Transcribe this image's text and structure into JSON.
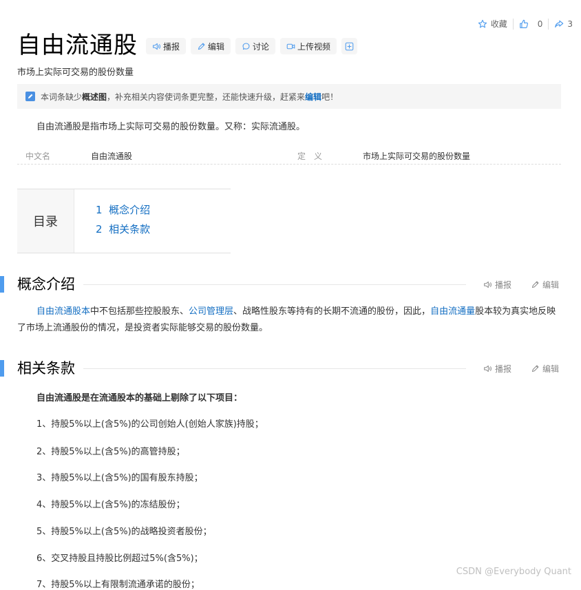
{
  "actions": {
    "favorite": "收藏",
    "like_count": "0",
    "share_count": "3"
  },
  "title": "自由流通股",
  "title_buttons": {
    "broadcast": "播报",
    "edit": "编辑",
    "discuss": "讨论",
    "upload_video": "上传视频"
  },
  "subtitle": "市场上实际可交易的股份数量",
  "notice": {
    "pre": "本词条缺少",
    "bold": "概述图",
    "mid": "，补充相关内容使词条更完整，还能快速升级，赶紧来",
    "link": "编辑",
    "post": "吧！"
  },
  "intro": "自由流通股是指市场上实际可交易的股份数量。又称：实际流通股。",
  "basic_info": {
    "k1": "中文名",
    "v1": "自由流通股",
    "k2": "定　义",
    "v2": "市场上实际可交易的股份数量"
  },
  "toc": {
    "label": "目录",
    "items": [
      {
        "num": "1",
        "text": "概念介绍"
      },
      {
        "num": "2",
        "text": "相关条款"
      }
    ]
  },
  "section1": {
    "title": "概念介绍",
    "broadcast": "播报",
    "edit": "编辑",
    "p": {
      "l1": "自由流通股本",
      "t1": "中不包括那些控股股东、",
      "l2": "公司管理层",
      "t2": "、战略性股东等持有的长期不流通的股份，因此，",
      "l3": "自由流通量",
      "t3": "股本较为真实地反映了市场上流通股份的情况，是投资者实际能够交易的股份数量。"
    }
  },
  "section2": {
    "title": "相关条款",
    "broadcast": "播报",
    "edit": "编辑",
    "lead": "自由流通股是在流通股本的基础上剔除了以下项目：",
    "items": [
      "1、持股5%以上(含5%)的公司创始人(创始人家族)持股；",
      "2、持股5%以上(含5%)的高管持股；",
      "3、持股5%以上(含5%)的国有股东持股；",
      "4、持股5%以上(含5%)的冻结股份；",
      "5、持股5%以上(含5%)的战略投资者股份；",
      "6、交叉持股且持股比例超过5%(含5%)；",
      "7、持股5%以上有限制流通承诺的股份；"
    ]
  },
  "watermark": "CSDN @Everybody Quant",
  "colors": {
    "link": "#136ec2",
    "accent": "#4f9cee"
  },
  "icons": [
    "star-icon",
    "thumbs-up-icon",
    "share-icon",
    "speaker-icon",
    "pencil-icon",
    "chat-icon",
    "video-icon",
    "plus-icon"
  ]
}
